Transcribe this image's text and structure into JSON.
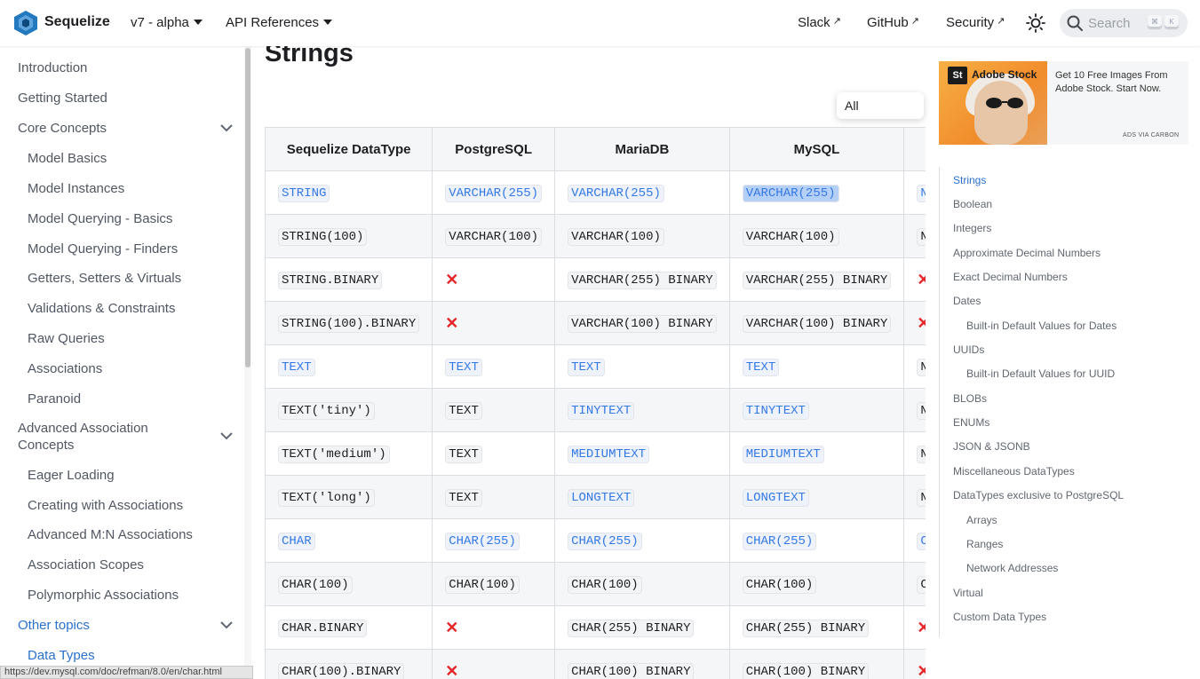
{
  "navbar": {
    "brand": "Sequelize",
    "version": "v7 - alpha",
    "api": "API References",
    "links": [
      "Slack",
      "GitHub",
      "Security"
    ],
    "search_placeholder": "Search",
    "kbd": [
      "⌘",
      "K"
    ]
  },
  "sidebar": {
    "items": [
      {
        "label": "Introduction"
      },
      {
        "label": "Getting Started"
      },
      {
        "label": "Core Concepts"
      },
      {
        "label": "Model Basics"
      },
      {
        "label": "Model Instances"
      },
      {
        "label": "Model Querying - Basics"
      },
      {
        "label": "Model Querying - Finders"
      },
      {
        "label": "Getters, Setters & Virtuals"
      },
      {
        "label": "Validations & Constraints"
      },
      {
        "label": "Raw Queries"
      },
      {
        "label": "Associations"
      },
      {
        "label": "Paranoid"
      },
      {
        "label": "Advanced Association"
      },
      {
        "label": "Concepts"
      },
      {
        "label": "Eager Loading"
      },
      {
        "label": "Creating with Associations"
      },
      {
        "label": "Advanced M:N Associations"
      },
      {
        "label": "Association Scopes"
      },
      {
        "label": "Polymorphic Associations"
      },
      {
        "label": "Other topics"
      },
      {
        "label": "Data Types"
      }
    ]
  },
  "status_url": "https://dev.mysql.com/doc/refman/8.0/en/char.html",
  "page": {
    "title": "Strings",
    "tab_popup": "All"
  },
  "table": {
    "headers": [
      "Sequelize DataType",
      "PostgreSQL",
      "MariaDB",
      "MySQL",
      ""
    ],
    "rows": [
      [
        {
          "t": "STRING",
          "link": true
        },
        {
          "t": "VARCHAR(255)",
          "link": true
        },
        {
          "t": "VARCHAR(255)",
          "link": true
        },
        {
          "t": "VARCHAR(255)",
          "link": true,
          "sel": true
        },
        {
          "t": "NVA",
          "link": true
        }
      ],
      [
        {
          "t": "STRING(100)"
        },
        {
          "t": "VARCHAR(100)"
        },
        {
          "t": "VARCHAR(100)"
        },
        {
          "t": "VARCHAR(100)"
        },
        {
          "t": "NVA"
        }
      ],
      [
        {
          "t": "STRING.BINARY"
        },
        {
          "x": true
        },
        {
          "t": "VARCHAR(255) BINARY"
        },
        {
          "t": "VARCHAR(255) BINARY"
        },
        {
          "x": true
        }
      ],
      [
        {
          "t": "STRING(100).BINARY"
        },
        {
          "x": true
        },
        {
          "t": "VARCHAR(100) BINARY"
        },
        {
          "t": "VARCHAR(100) BINARY"
        },
        {
          "x": true
        }
      ],
      [
        {
          "t": "TEXT",
          "link": true
        },
        {
          "t": "TEXT",
          "link": true
        },
        {
          "t": "TEXT",
          "link": true
        },
        {
          "t": "TEXT",
          "link": true
        },
        {
          "t": "NVA"
        }
      ],
      [
        {
          "t": "TEXT('tiny')"
        },
        {
          "t": "TEXT"
        },
        {
          "t": "TINYTEXT",
          "link": true
        },
        {
          "t": "TINYTEXT",
          "link": true
        },
        {
          "t": "NVA"
        }
      ],
      [
        {
          "t": "TEXT('medium')"
        },
        {
          "t": "TEXT"
        },
        {
          "t": "MEDIUMTEXT",
          "link": true
        },
        {
          "t": "MEDIUMTEXT",
          "link": true
        },
        {
          "t": "NVA"
        }
      ],
      [
        {
          "t": "TEXT('long')"
        },
        {
          "t": "TEXT"
        },
        {
          "t": "LONGTEXT",
          "link": true
        },
        {
          "t": "LONGTEXT",
          "link": true
        },
        {
          "t": "NVA"
        }
      ],
      [
        {
          "t": "CHAR",
          "link": true
        },
        {
          "t": "CHAR(255)",
          "link": true
        },
        {
          "t": "CHAR(255)",
          "link": true
        },
        {
          "t": "CHAR(255)",
          "link": true
        },
        {
          "t": "CHA",
          "link": true
        }
      ],
      [
        {
          "t": "CHAR(100)"
        },
        {
          "t": "CHAR(100)"
        },
        {
          "t": "CHAR(100)"
        },
        {
          "t": "CHAR(100)"
        },
        {
          "t": "CHA"
        }
      ],
      [
        {
          "t": "CHAR.BINARY"
        },
        {
          "x": true
        },
        {
          "t": "CHAR(255) BINARY"
        },
        {
          "t": "CHAR(255) BINARY"
        },
        {
          "x": true
        }
      ],
      [
        {
          "t": "CHAR(100).BINARY"
        },
        {
          "x": true
        },
        {
          "t": "CHAR(100) BINARY"
        },
        {
          "t": "CHAR(100) BINARY"
        },
        {
          "x": true
        }
      ]
    ]
  },
  "ad": {
    "brand": "Adobe Stock",
    "logo_text": "St",
    "text": "Get 10 Free Images From Adobe Stock. Start Now.",
    "via": "ADS VIA CARBON"
  },
  "toc": {
    "items": [
      {
        "label": "Strings"
      },
      {
        "label": "Boolean"
      },
      {
        "label": "Integers"
      },
      {
        "label": "Approximate Decimal Numbers"
      },
      {
        "label": "Exact Decimal Numbers"
      },
      {
        "label": "Dates"
      },
      {
        "label": "Built-in Default Values for Dates"
      },
      {
        "label": "UUIDs"
      },
      {
        "label": "Built-in Default Values for UUID"
      },
      {
        "label": "BLOBs"
      },
      {
        "label": "ENUMs"
      },
      {
        "label": "JSON & JSONB"
      },
      {
        "label": "Miscellaneous DataTypes"
      },
      {
        "label": "DataTypes exclusive to PostgreSQL"
      },
      {
        "label": "Arrays"
      },
      {
        "label": "Ranges"
      },
      {
        "label": "Network Addresses"
      },
      {
        "label": "Virtual"
      },
      {
        "label": "Custom Data Types"
      }
    ]
  }
}
